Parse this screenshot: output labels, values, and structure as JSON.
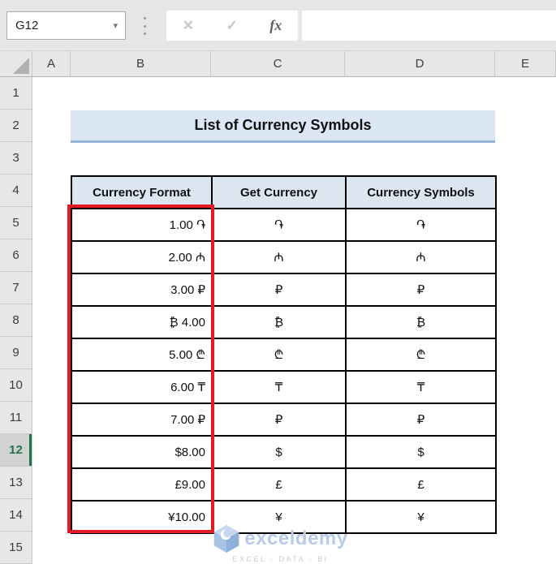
{
  "formula_bar": {
    "name_box": "G12",
    "dropdown_icon": "▾",
    "cancel_icon": "✕",
    "enter_icon": "✓",
    "fx_icon": "fx",
    "formula_value": ""
  },
  "grid": {
    "column_headers": [
      "A",
      "B",
      "C",
      "D",
      "E"
    ],
    "row_headers": [
      "1",
      "2",
      "3",
      "4",
      "5",
      "6",
      "7",
      "8",
      "9",
      "10",
      "11",
      "12",
      "13",
      "14",
      "15"
    ],
    "active_row": "12"
  },
  "sheet": {
    "title": "List of Currency Symbols",
    "table": {
      "headers": [
        "Currency Format",
        "Get Currency",
        "Currency Symbols"
      ],
      "rows": [
        {
          "currency_format": "1.00 ֏",
          "get_currency": "֏",
          "currency_symbol": "֏"
        },
        {
          "currency_format": "2.00 ₼",
          "get_currency": "₼",
          "currency_symbol": "₼"
        },
        {
          "currency_format": "3.00 ₽",
          "get_currency": "₽",
          "currency_symbol": "₽"
        },
        {
          "currency_format": "₿ 4.00",
          "get_currency": "₿",
          "currency_symbol": "₿"
        },
        {
          "currency_format": "5.00 ₾",
          "get_currency": "₾",
          "currency_symbol": "₾"
        },
        {
          "currency_format": "6.00 ₸",
          "get_currency": "₸",
          "currency_symbol": "₸"
        },
        {
          "currency_format": "7.00 ₽",
          "get_currency": "₽",
          "currency_symbol": "₽"
        },
        {
          "currency_format": "$8.00",
          "get_currency": "$",
          "currency_symbol": "$"
        },
        {
          "currency_format": "£9.00",
          "get_currency": "£",
          "currency_symbol": "£"
        },
        {
          "currency_format": "¥10.00",
          "get_currency": "¥",
          "currency_symbol": "¥"
        }
      ]
    }
  },
  "watermark": {
    "brand": "exceldemy",
    "tagline": "EXCEL - DATA - BI"
  },
  "colors": {
    "title_fill": "#dbe7f4",
    "title_border": "#95b3d7",
    "table_header_fill": "#dce6f1",
    "table_border": "#000000",
    "highlight_red": "#e41b23",
    "active_green": "#1e7545",
    "watermark_blue": "#b7cbe9"
  }
}
